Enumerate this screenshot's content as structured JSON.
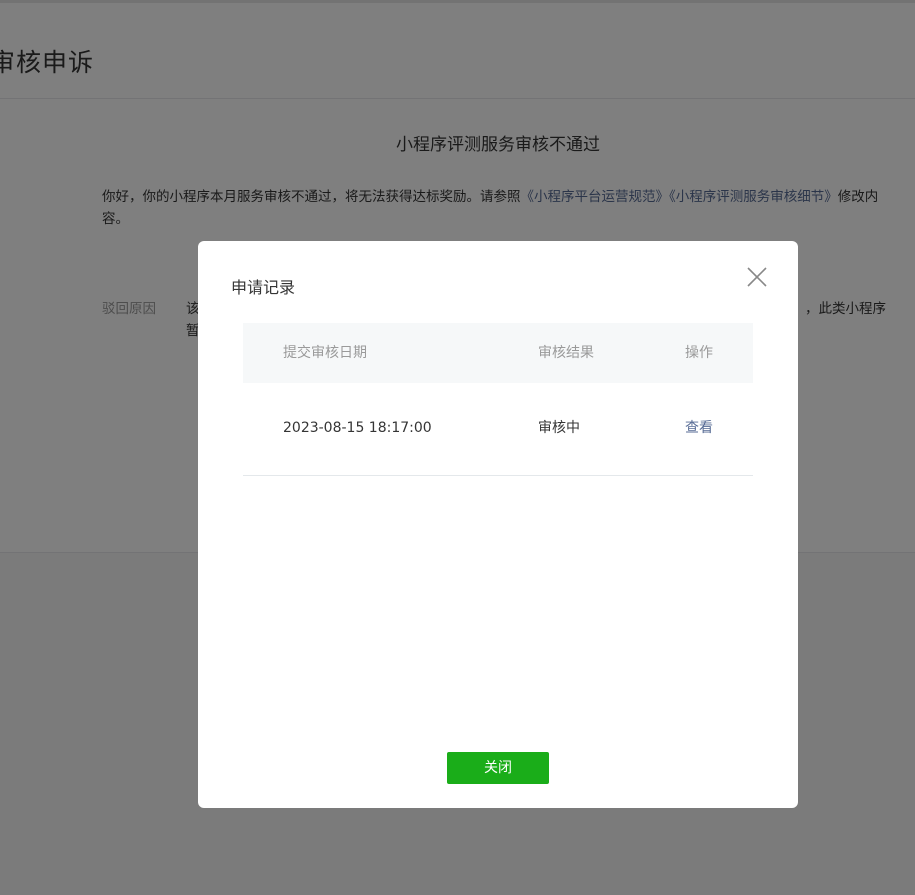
{
  "page": {
    "title": "审核申诉",
    "notice": {
      "title": "小程序评测服务审核不通过",
      "body_prefix": "你好，你的小程序本月服务审核不通过，将无法获得达标奖励。请参照",
      "link_1": "《小程序平台运营规范》",
      "link_2": "《小程序评测服务审核细节》",
      "body_suffix": "修改内容。"
    },
    "reject": {
      "label": "驳回原因",
      "text_line1_start": "该",
      "text_line2_start": "暂",
      "text_line1_end": "，此类小程序"
    }
  },
  "dialog": {
    "title": "申请记录",
    "table": {
      "headers": [
        "提交审核日期",
        "审核结果",
        "操作"
      ],
      "rows": [
        {
          "date": "2023-08-15 18:17:00",
          "result": "审核中",
          "action": "查看"
        }
      ]
    },
    "close_button": "关闭"
  },
  "colors": {
    "primary_green": "#1aad19",
    "link_blue": "#576b95",
    "mask": "rgba(0,0,0,0.5)"
  }
}
